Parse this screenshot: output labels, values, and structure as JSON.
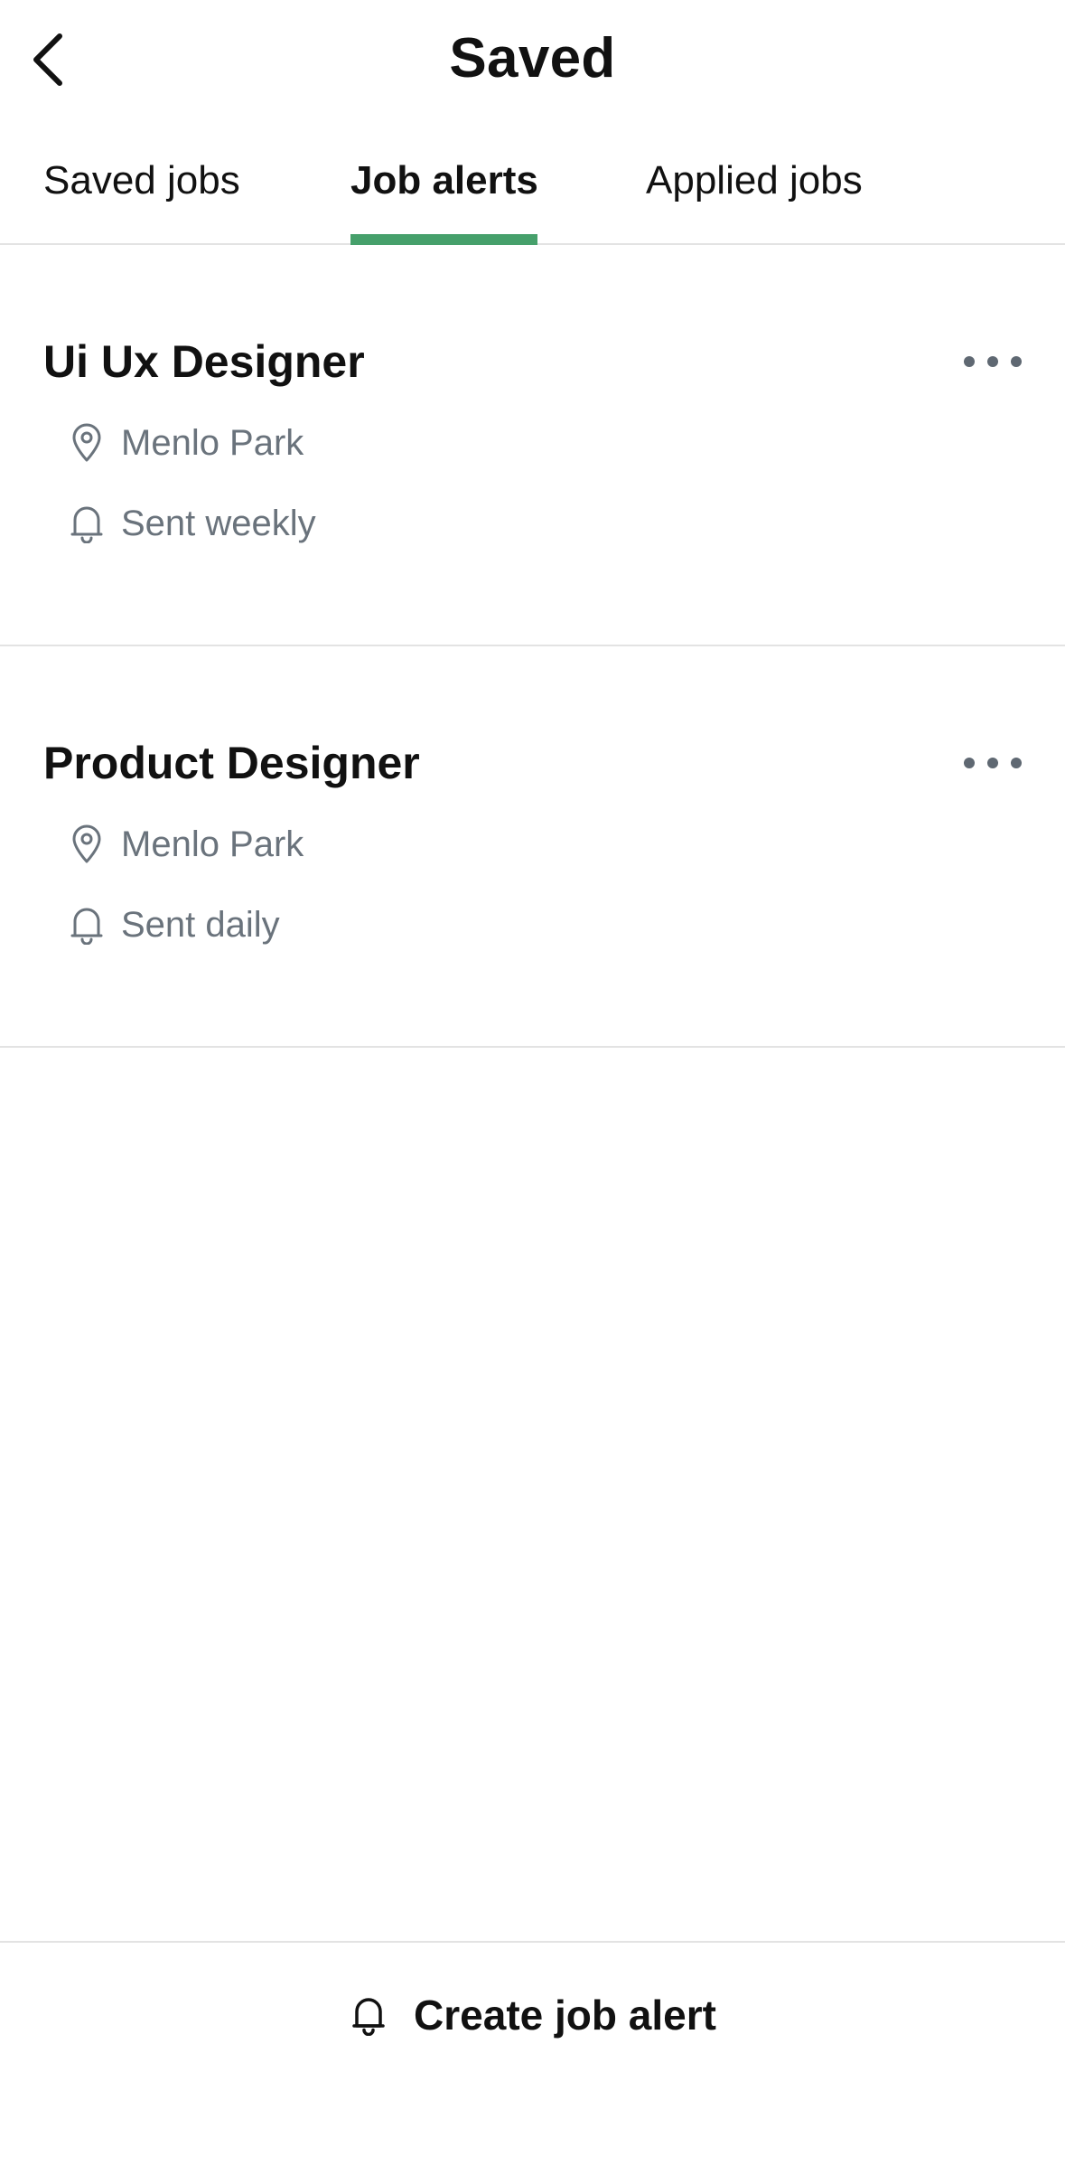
{
  "header": {
    "title": "Saved",
    "back_icon": "chevron-left-icon"
  },
  "tabs": [
    {
      "label": "Saved jobs",
      "active": false
    },
    {
      "label": "Job alerts",
      "active": true
    },
    {
      "label": "Applied jobs",
      "active": false
    }
  ],
  "accent_color": "#46a06b",
  "alerts": [
    {
      "title": "Ui Ux Designer",
      "location": "Menlo Park",
      "frequency": "Sent weekly",
      "location_icon": "location-pin-icon",
      "frequency_icon": "bell-icon",
      "menu_icon": "more-horizontal-icon"
    },
    {
      "title": "Product Designer",
      "location": "Menlo Park",
      "frequency": "Sent daily",
      "location_icon": "location-pin-icon",
      "frequency_icon": "bell-icon",
      "menu_icon": "more-horizontal-icon"
    }
  ],
  "footer": {
    "create_label": "Create job alert",
    "create_icon": "bell-icon"
  }
}
